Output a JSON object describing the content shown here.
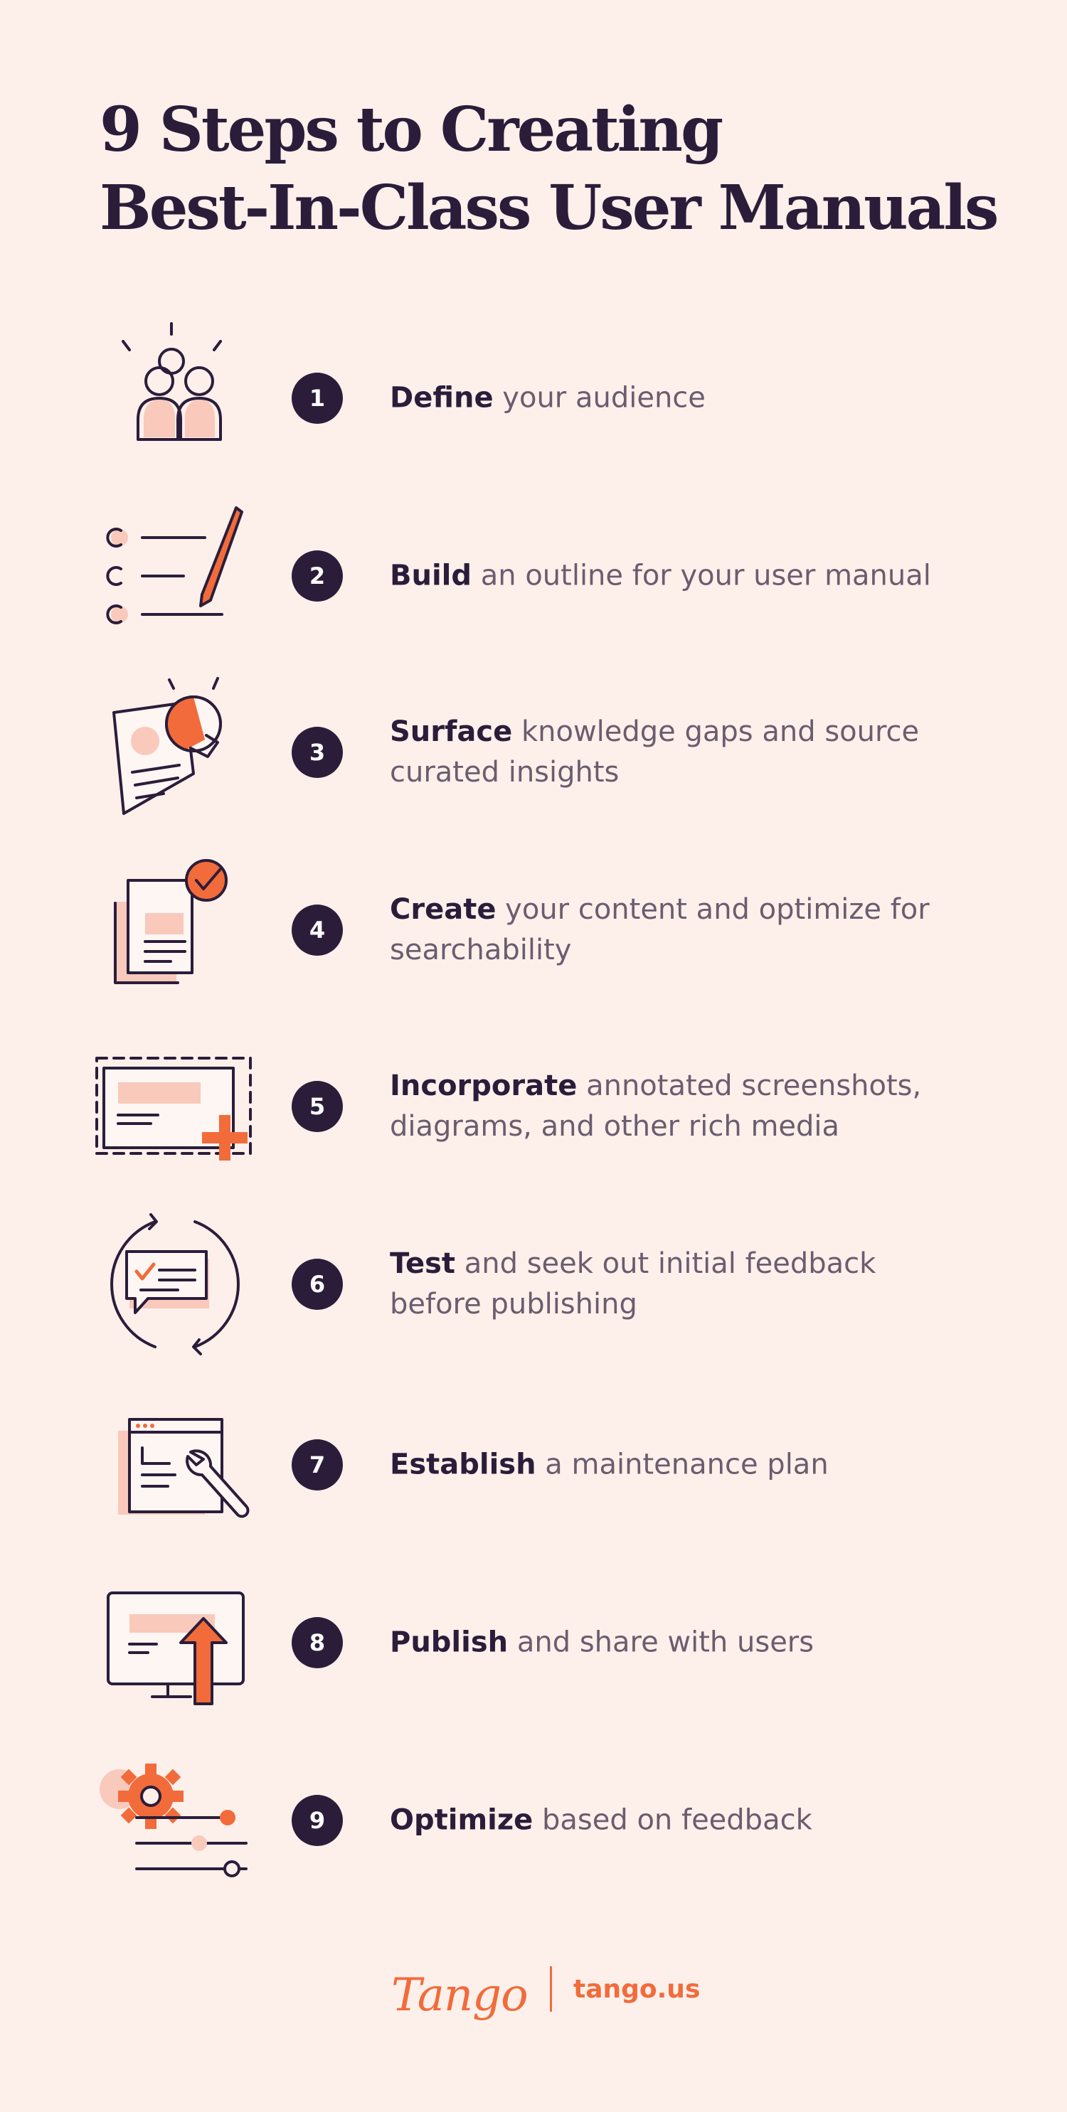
{
  "title": {
    "line1": "9 Steps to Creating",
    "line2": "Best-In-Class User Manuals"
  },
  "colors": {
    "background": "#fdf0eb",
    "ink": "#2b1d3a",
    "muted": "#6b5d6e",
    "accent": "#f26b3a",
    "pink": "#f9c9bc"
  },
  "steps": [
    {
      "number": "1",
      "bold": "Define",
      "rest": " your audience",
      "icon": "audience-icon"
    },
    {
      "number": "2",
      "bold": "Build",
      "rest": " an outline for your user manual",
      "icon": "outline-checklist-icon"
    },
    {
      "number": "3",
      "bold": "Surface",
      "rest": " knowledge gaps and source curated insights",
      "icon": "lightbulb-document-icon"
    },
    {
      "number": "4",
      "bold": "Create",
      "rest": " your content and optimize for searchability",
      "icon": "document-checkmark-icon"
    },
    {
      "number": "5",
      "bold": "Incorporate",
      "rest": " annotated screenshots, diagrams, and other rich media",
      "icon": "add-media-icon"
    },
    {
      "number": "6",
      "bold": "Test",
      "rest": " and seek out initial feedback before publishing",
      "icon": "feedback-cycle-icon"
    },
    {
      "number": "7",
      "bold": "Establish",
      "rest": " a maintenance plan",
      "icon": "maintenance-wrench-icon"
    },
    {
      "number": "8",
      "bold": "Publish",
      "rest": " and share with users",
      "icon": "publish-upload-icon"
    },
    {
      "number": "9",
      "bold": "Optimize",
      "rest": " based on feedback",
      "icon": "settings-gear-icon"
    }
  ],
  "footer": {
    "logo": "Tango",
    "url": "tango.us"
  }
}
